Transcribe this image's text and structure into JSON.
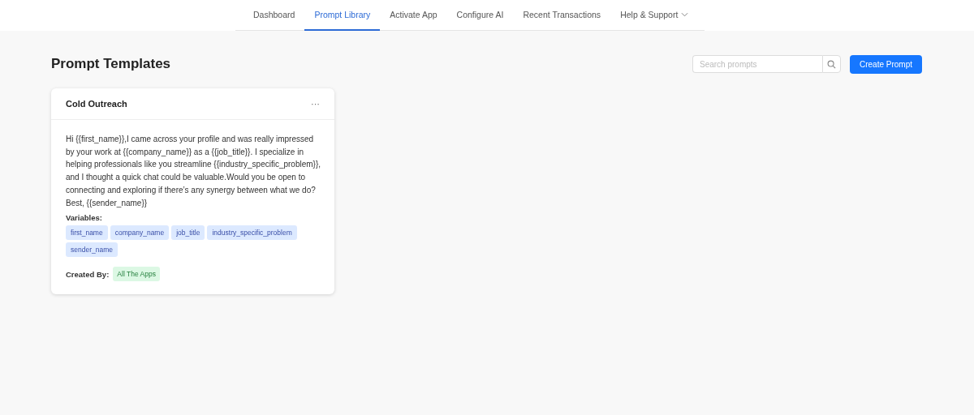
{
  "nav": {
    "tabs": [
      {
        "label": "Dashboard",
        "selected": false,
        "dropdown": false
      },
      {
        "label": "Prompt Library",
        "selected": true,
        "dropdown": false
      },
      {
        "label": "Activate App",
        "selected": false,
        "dropdown": false
      },
      {
        "label": "Configure AI",
        "selected": false,
        "dropdown": false
      },
      {
        "label": "Recent Transactions",
        "selected": false,
        "dropdown": false
      },
      {
        "label": "Help & Support",
        "selected": false,
        "dropdown": true
      }
    ]
  },
  "page": {
    "title": "Prompt Templates",
    "search": {
      "placeholder": "Search prompts"
    },
    "create_button": "Create Prompt"
  },
  "cards": [
    {
      "title": "Cold Outreach",
      "menu": "···",
      "body": "Hi {{first_name}},I came across your profile and was really impressed by your work at {{company_name}} as a {{job_title}}. I specialize in helping professionals like you streamline {{industry_specific_problem}}, and I thought a quick chat could be valuable.Would you be open to connecting and exploring if there’s any synergy between what we do? Best,  {{sender_name}}",
      "variables_label": "Variables:",
      "variables": [
        "first_name",
        "company_name",
        "job_title",
        "industry_specific_problem",
        "sender_name"
      ],
      "created_by_label": "Created By:",
      "created_by": "All The Apps"
    }
  ]
}
